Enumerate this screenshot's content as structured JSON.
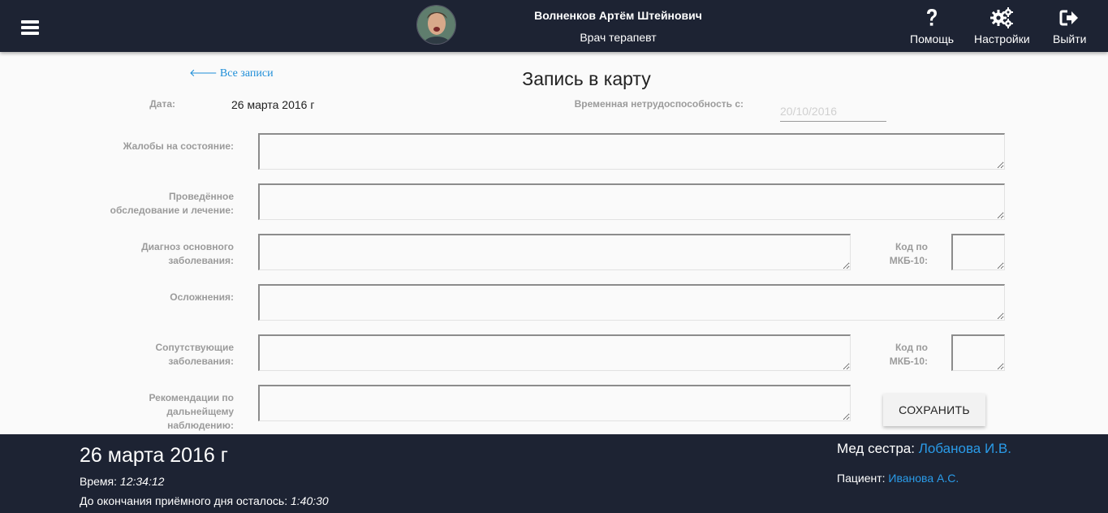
{
  "header": {
    "doctor_name": "Волненков Артём Штейнович",
    "doctor_role": "Врач терапевт",
    "help_label": "Помощь",
    "settings_label": "Настройки",
    "logout_label": "Выйти",
    "icons": [
      "menu-icon",
      "question-icon",
      "gears-icon",
      "sign-out-icon"
    ]
  },
  "main": {
    "back_link": "Все записи",
    "title": "Запись в карту",
    "date_label": "Дата:",
    "date_value": "26 марта 2016 г",
    "disability_label": "Временная нетрудоспособность с:",
    "disability_placeholder": "20/10/2016",
    "complaints_label": "Жалобы на состояние:",
    "exam_label": "Проведённое обследование и лечение:",
    "diagnosis_label": "Диагноз основного заболевания:",
    "icd_label": "Код по МКБ-10:",
    "complications_label": "Осложнения:",
    "concomitant_label": "Сопутствующие заболевания:",
    "icd_label2": "Код по МКБ-10:",
    "recommendations_label": "Рекомендации по дальнейщему наблюдению:",
    "save_label": "СОХРАНИТЬ"
  },
  "footer": {
    "date": "26 марта 2016 г",
    "time_label": "Время:",
    "time_value": "12:34:12",
    "remaining_label": "До окончания приёмного дня осталось:",
    "remaining_value": "1:40:30",
    "nurse_label": "Мед сестра:",
    "nurse_name": "Лобанова И.В.",
    "patient_label": "Пациент:",
    "patient_name": "Иванова А.С."
  },
  "colors": {
    "header_bg": "#1d2333",
    "link": "#1e8ed8",
    "label_gray": "#9b9b9b"
  }
}
